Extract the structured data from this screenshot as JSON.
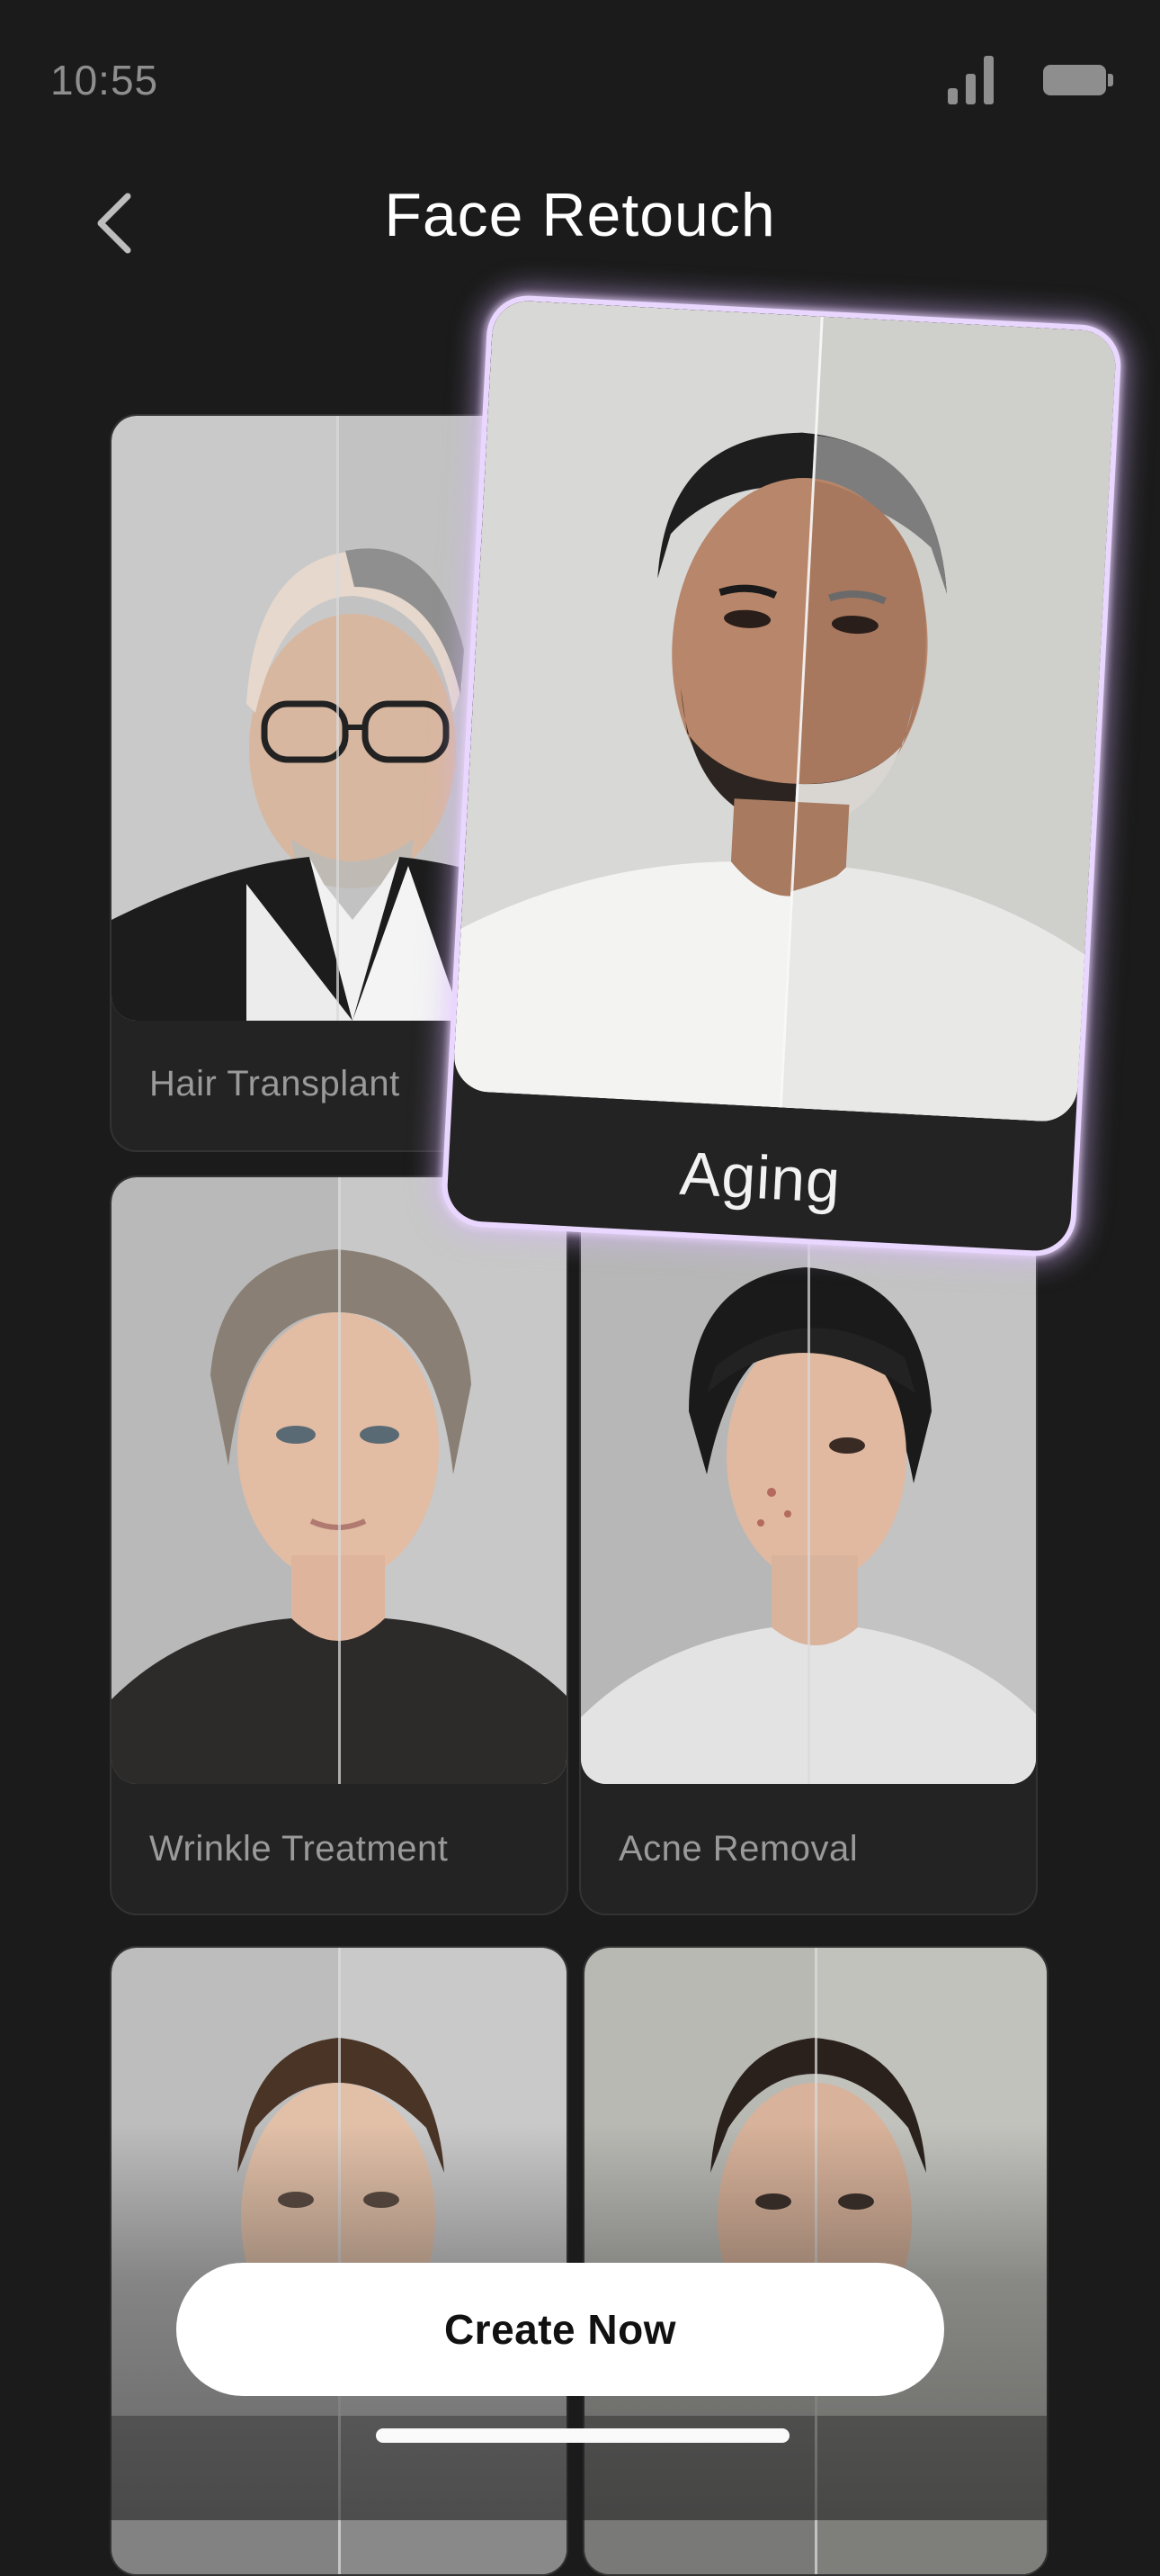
{
  "status_bar": {
    "time": "10:55",
    "signal_icon": "signal-bars-icon",
    "battery_icon": "battery-icon"
  },
  "header": {
    "back_icon": "chevron-left-icon",
    "title": "Face Retouch"
  },
  "featured": {
    "label": "Aging",
    "glow_color": "#ead7ff"
  },
  "cards": [
    {
      "label": "Hair Transplant"
    },
    {
      "label": "Wrinkle Treatment"
    },
    {
      "label": "Acne Removal"
    },
    {
      "label": ""
    },
    {
      "label": ""
    }
  ],
  "cta": {
    "label": "Create Now"
  }
}
